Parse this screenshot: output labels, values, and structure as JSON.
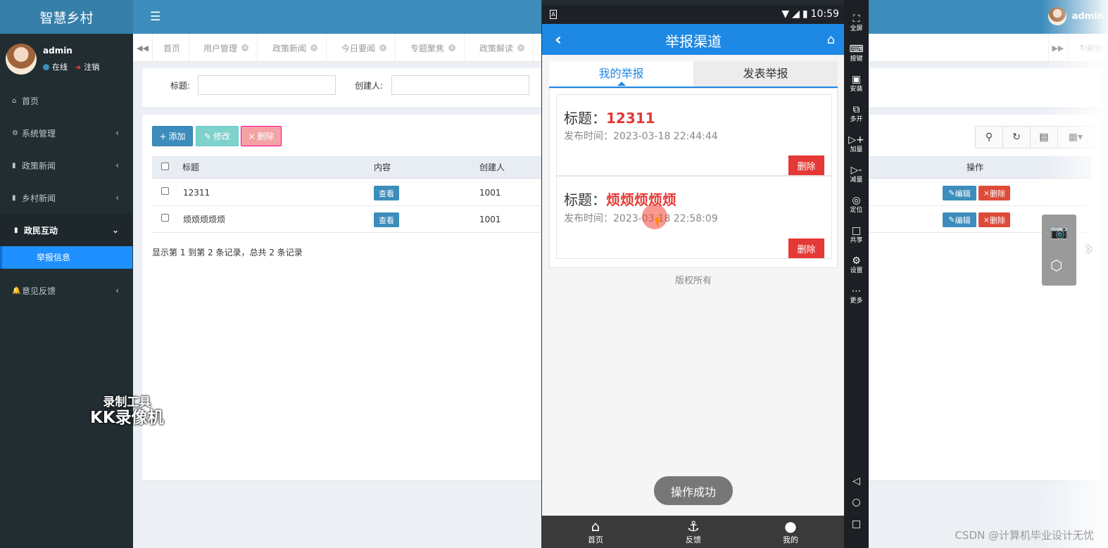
{
  "admin": {
    "logo": "智慧乡村",
    "top_user": "admin",
    "user": {
      "name": "admin",
      "status": "在线",
      "logout": "注销"
    },
    "menu": [
      {
        "label": "首页",
        "icon": "home-icon"
      },
      {
        "label": "系统管理",
        "icon": "gear-icon"
      },
      {
        "label": "政策新闻",
        "icon": "book-icon"
      },
      {
        "label": "乡村新闻",
        "icon": "book-icon"
      },
      {
        "label": "政民互动",
        "icon": "book-icon"
      },
      {
        "label": "举报信息",
        "icon": ""
      },
      {
        "label": "意见反馈",
        "icon": "bell-icon"
      }
    ],
    "tabs": [
      {
        "label": "首页"
      },
      {
        "label": "用户管理"
      },
      {
        "label": "政策新闻"
      },
      {
        "label": "今日要闻"
      },
      {
        "label": "专题聚焦"
      },
      {
        "label": "政策解读"
      }
    ],
    "refresh_label": "刷新",
    "filters": {
      "title_label": "标题:",
      "creator_label": "创建人:"
    },
    "buttons": {
      "add": "添加",
      "edit": "修改",
      "delete": "删除"
    },
    "table": {
      "headers": {
        "title": "标题",
        "content": "内容",
        "creator": "创建人",
        "ops": "操作"
      },
      "rows": [
        {
          "title": "12311",
          "view": "查看",
          "creator": "1001",
          "edit": "编辑",
          "delete": "删除"
        },
        {
          "title": "烦烦烦烦烦",
          "view": "查看",
          "creator": "1001",
          "edit": "编辑",
          "delete": "删除"
        }
      ]
    },
    "pager": "显示第 1 到第 2 条记录，总共 2 条记录"
  },
  "watermark": {
    "line1": "录制工具",
    "line2": "KK录像机"
  },
  "csdn": "CSDN @计算机毕业设计无忧",
  "emulator": {
    "clock": "10:59",
    "app": {
      "title": "举报渠道",
      "tabs": {
        "mine": "我的举报",
        "publish": "发表举报"
      },
      "cards": [
        {
          "title_label": "标题：",
          "title": "12311",
          "time": "发布时间：2023-03-18 22:44:44",
          "delete": "删除"
        },
        {
          "title_label": "标题：",
          "title": "烦烦烦烦烦",
          "time": "发布时间：2023-03-18 22:58:09",
          "delete": "删除"
        }
      ],
      "copyright": "版权所有",
      "toast": "操作成功",
      "bottom_nav": [
        {
          "label": "首页",
          "icon": "home-icon"
        },
        {
          "label": "反馈",
          "icon": "anchor-icon"
        },
        {
          "label": "我的",
          "icon": "person-icon"
        }
      ]
    },
    "side_tools": [
      {
        "label": "全屏",
        "icon": "fullscreen-icon"
      },
      {
        "label": "按键",
        "icon": "keyboard-icon"
      },
      {
        "label": "安装",
        "icon": "apk-icon"
      },
      {
        "label": "多开",
        "icon": "multi-window-icon"
      },
      {
        "label": "加量",
        "icon": "volume-up-icon"
      },
      {
        "label": "减量",
        "icon": "volume-down-icon"
      },
      {
        "label": "定位",
        "icon": "location-icon"
      },
      {
        "label": "共享",
        "icon": "folder-icon"
      },
      {
        "label": "设置",
        "icon": "gear-icon"
      },
      {
        "label": "更多",
        "icon": "more-icon"
      }
    ]
  }
}
